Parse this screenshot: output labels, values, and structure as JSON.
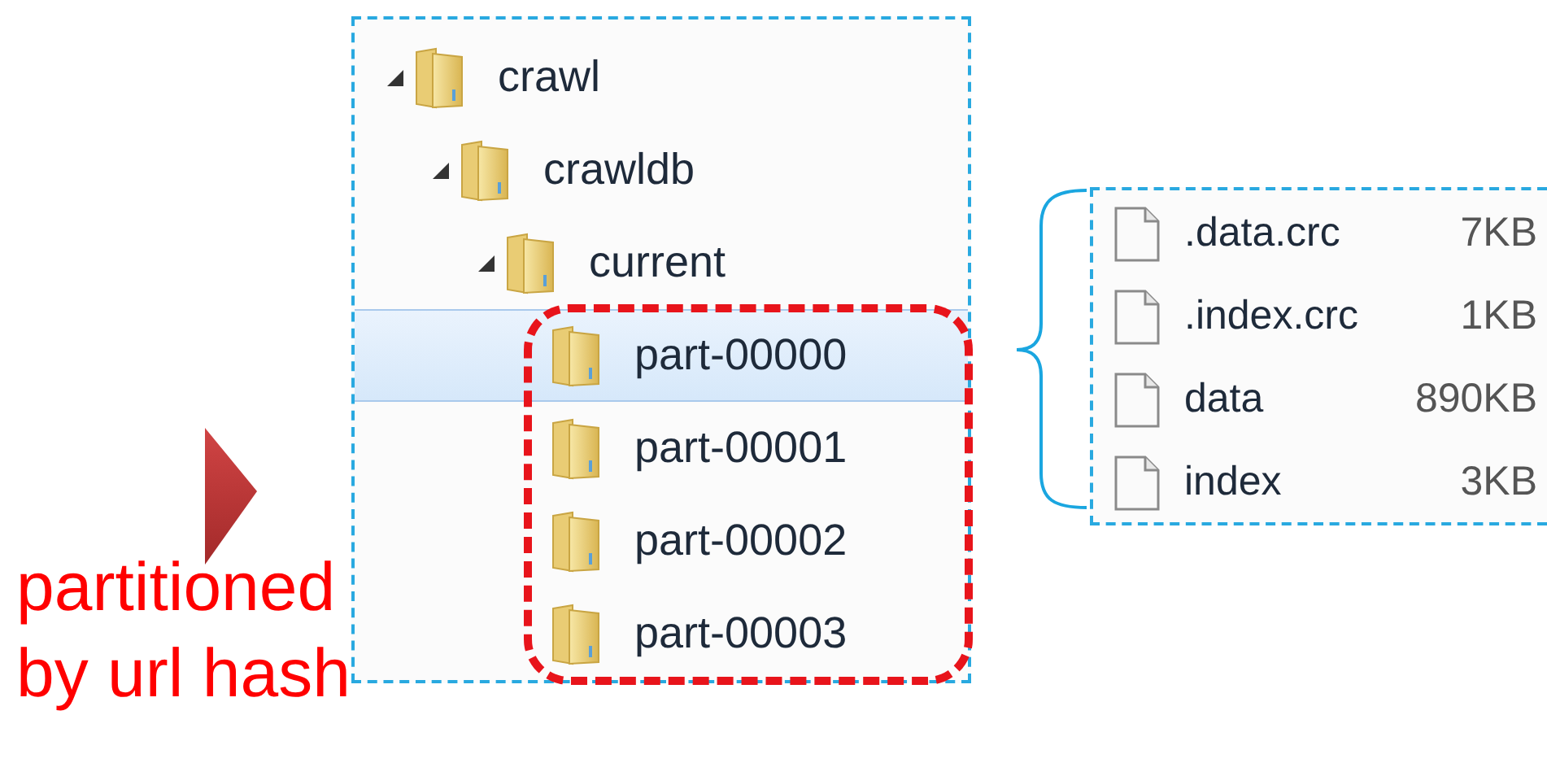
{
  "tree": [
    {
      "name": "crawl",
      "expanded": true,
      "selected": false,
      "children": [
        {
          "name": "crawldb",
          "expanded": true,
          "selected": false,
          "children": [
            {
              "name": "current",
              "expanded": true,
              "selected": false,
              "highlight_children": true,
              "children": [
                {
                  "name": "part-00000",
                  "selected": true
                },
                {
                  "name": "part-00001",
                  "selected": false
                },
                {
                  "name": "part-00002",
                  "selected": false
                },
                {
                  "name": "part-00003",
                  "selected": false
                }
              ]
            }
          ]
        }
      ]
    }
  ],
  "files": [
    {
      "name": ".data.crc",
      "size": "7KB"
    },
    {
      "name": ".index.crc",
      "size": "1KB"
    },
    {
      "name": "data",
      "size": "890KB"
    },
    {
      "name": "index",
      "size": "3KB"
    }
  ],
  "caption": "partitioned by url hash"
}
